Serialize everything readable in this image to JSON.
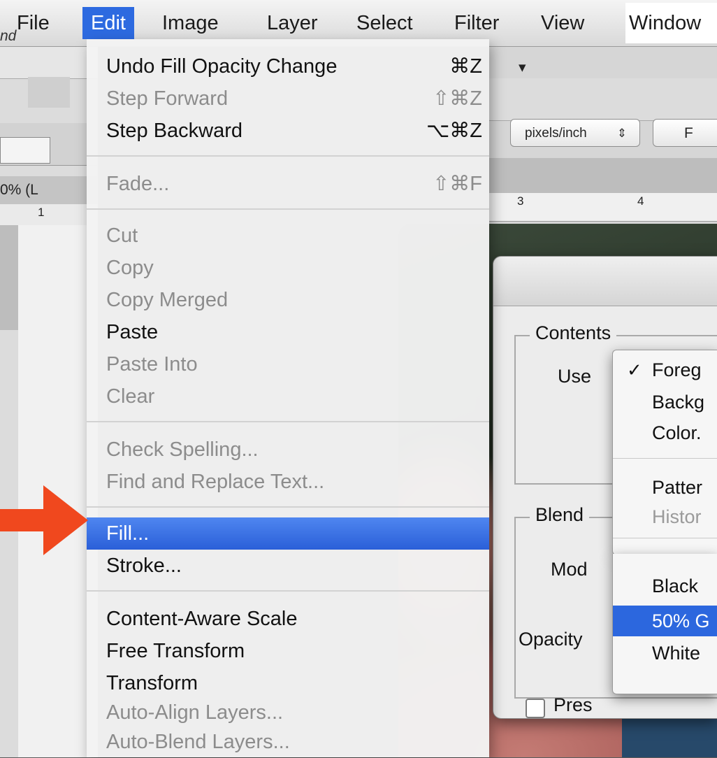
{
  "menubar": {
    "items": [
      "File",
      "Edit",
      "Image",
      "Layer",
      "Select",
      "Filter",
      "View",
      "Window"
    ],
    "active": "Edit"
  },
  "edit_menu": {
    "items": [
      {
        "label": "Undo Fill Opacity Change",
        "shortcut": "⌘Z",
        "enabled": true
      },
      {
        "label": "Step Forward",
        "shortcut": "⇧⌘Z",
        "enabled": false
      },
      {
        "label": "Step Backward",
        "shortcut": "⌥⌘Z",
        "enabled": true
      },
      {
        "label": "Fade...",
        "shortcut": "⇧⌘F",
        "enabled": false
      },
      {
        "label": "Cut",
        "shortcut": "",
        "enabled": false
      },
      {
        "label": "Copy",
        "shortcut": "",
        "enabled": false
      },
      {
        "label": "Copy Merged",
        "shortcut": "",
        "enabled": false
      },
      {
        "label": "Paste",
        "shortcut": "",
        "enabled": true
      },
      {
        "label": "Paste Into",
        "shortcut": "",
        "enabled": false
      },
      {
        "label": "Clear",
        "shortcut": "",
        "enabled": false
      },
      {
        "label": "Check Spelling...",
        "shortcut": "",
        "enabled": false
      },
      {
        "label": "Find and Replace Text...",
        "shortcut": "",
        "enabled": false
      },
      {
        "label": "Fill...",
        "shortcut": "",
        "enabled": true,
        "highlighted": true
      },
      {
        "label": "Stroke...",
        "shortcut": "",
        "enabled": true
      },
      {
        "label": "Content-Aware Scale",
        "shortcut": "",
        "enabled": true
      },
      {
        "label": "Free Transform",
        "shortcut": "",
        "enabled": true
      },
      {
        "label": "Transform",
        "shortcut": "",
        "enabled": true
      },
      {
        "label": "Auto-Align Layers...",
        "shortcut": "",
        "enabled": false
      },
      {
        "label": "Auto-Blend Layers...",
        "shortcut": "",
        "enabled": false
      }
    ]
  },
  "app_chrome": {
    "left_tab_fragment": "nd",
    "zoom_tab_fragment": "0% (L",
    "units_select": "pixels/inch",
    "units_arrows": "⇕",
    "f_button": "F",
    "mode_icon": "▾",
    "ruler_labels": [
      "1",
      "3",
      "4"
    ]
  },
  "fill_dialog": {
    "contents_label": "Contents",
    "use_label": "Use",
    "blending_label": "Blend",
    "mode_label": "Mod",
    "opacity_label": "Opacity",
    "preserve_label": "Pres",
    "use_menu": {
      "items": [
        {
          "label": "Foreg",
          "checked": true,
          "enabled": true
        },
        {
          "label": "Backg",
          "enabled": true
        },
        {
          "label": "Color.",
          "enabled": true
        },
        {
          "label": "Patter",
          "enabled": true
        },
        {
          "label": "Histor",
          "enabled": false
        },
        {
          "label": "Black",
          "enabled": true
        },
        {
          "label": "50% G",
          "enabled": true,
          "selected": true
        },
        {
          "label": "White",
          "enabled": true
        }
      ],
      "check_glyph": "✓"
    }
  },
  "colors": {
    "menu_highlight": "#2d6ae0",
    "arrow": "#f0481e"
  }
}
